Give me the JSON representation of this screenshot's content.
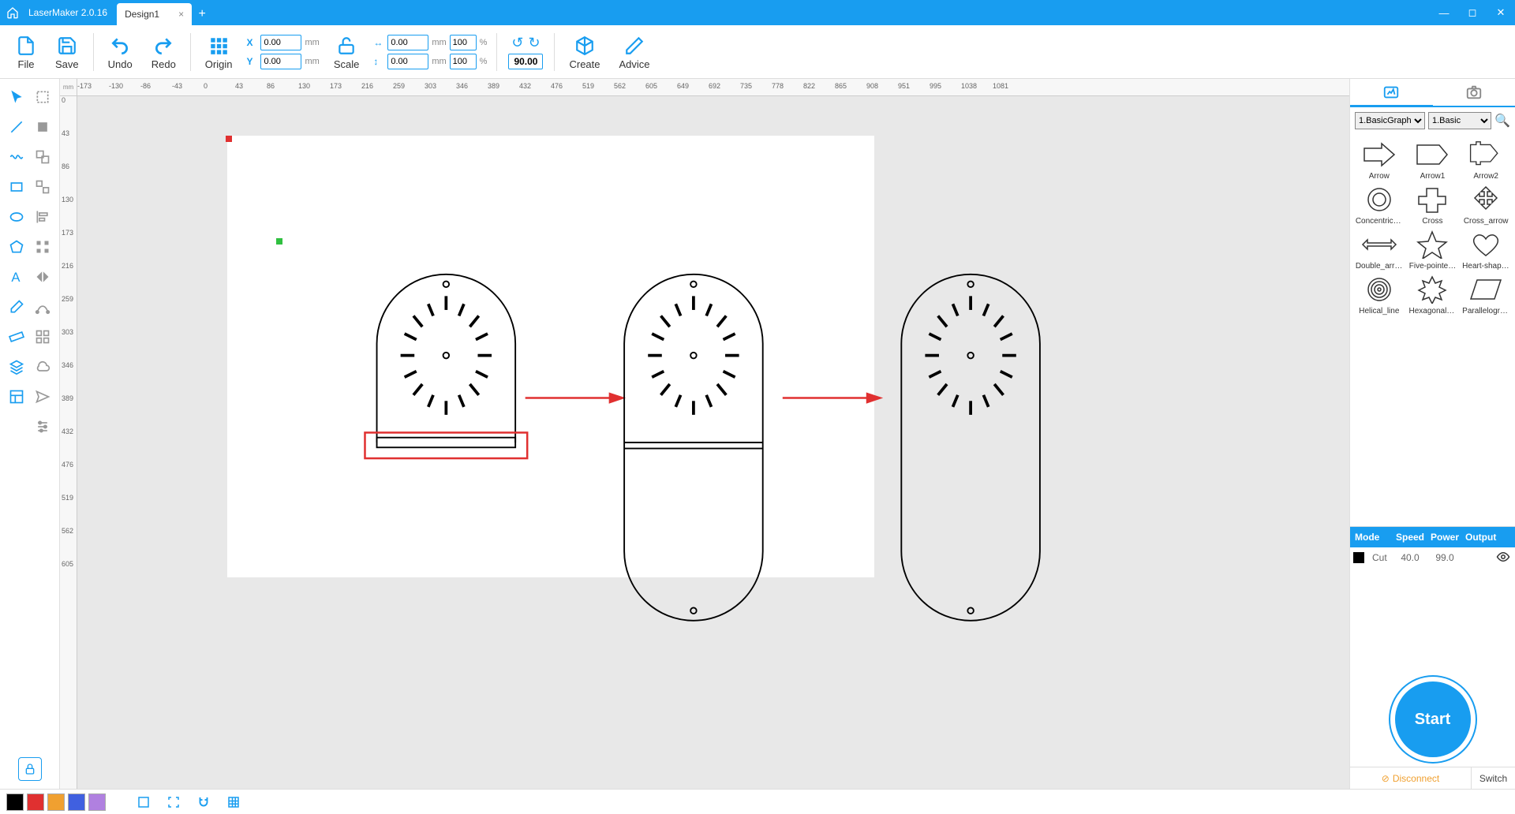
{
  "app": {
    "name": "LaserMaker 2.0.16"
  },
  "tabs": {
    "active": "Design1"
  },
  "toolbar": {
    "file": "File",
    "save": "Save",
    "undo": "Undo",
    "redo": "Redo",
    "origin": "Origin",
    "scale": "Scale",
    "create": "Create",
    "advice": "Advice",
    "x_label": "X",
    "x_value": "0.00",
    "y_label": "Y",
    "y_value": "0.00",
    "w_value": "0.00",
    "h_value": "0.00",
    "w_pct": "100",
    "h_pct": "100",
    "mm": "mm",
    "pct": "%",
    "rotation": "90.00"
  },
  "ruler": {
    "unit": "mm",
    "h": [
      "-173",
      "-130",
      "-86",
      "-43",
      "0",
      "43",
      "86",
      "130",
      "173",
      "216",
      "259",
      "303",
      "346",
      "389",
      "432",
      "476",
      "519",
      "562",
      "605",
      "649",
      "692",
      "735",
      "778",
      "822",
      "865",
      "908",
      "951",
      "995",
      "1038",
      "1081"
    ],
    "v": [
      "0",
      "43",
      "86",
      "130",
      "173",
      "216",
      "259",
      "303",
      "346",
      "389",
      "432",
      "476",
      "519",
      "562",
      "605"
    ]
  },
  "library": {
    "cat1": "1.BasicGraph",
    "cat2": "1.Basic",
    "shapes": [
      "Arrow",
      "Arrow1",
      "Arrow2",
      "Concentric_…",
      "Cross",
      "Cross_arrow",
      "Double_arrow",
      "Five-pointe…",
      "Heart-shaped",
      "Helical_line",
      "Hexagonal_…",
      "Parallelogram"
    ]
  },
  "layer": {
    "hdr_mode": "Mode",
    "hdr_speed": "Speed",
    "hdr_power": "Power",
    "hdr_output": "Output",
    "row_mode": "Cut",
    "row_speed": "40.0",
    "row_power": "99.0"
  },
  "start": "Start",
  "conn": {
    "status": "Disconnect",
    "switch": "Switch"
  },
  "colors": [
    "#000000",
    "#e03030",
    "#f0a030",
    "#4060e0",
    "#b080e0"
  ]
}
